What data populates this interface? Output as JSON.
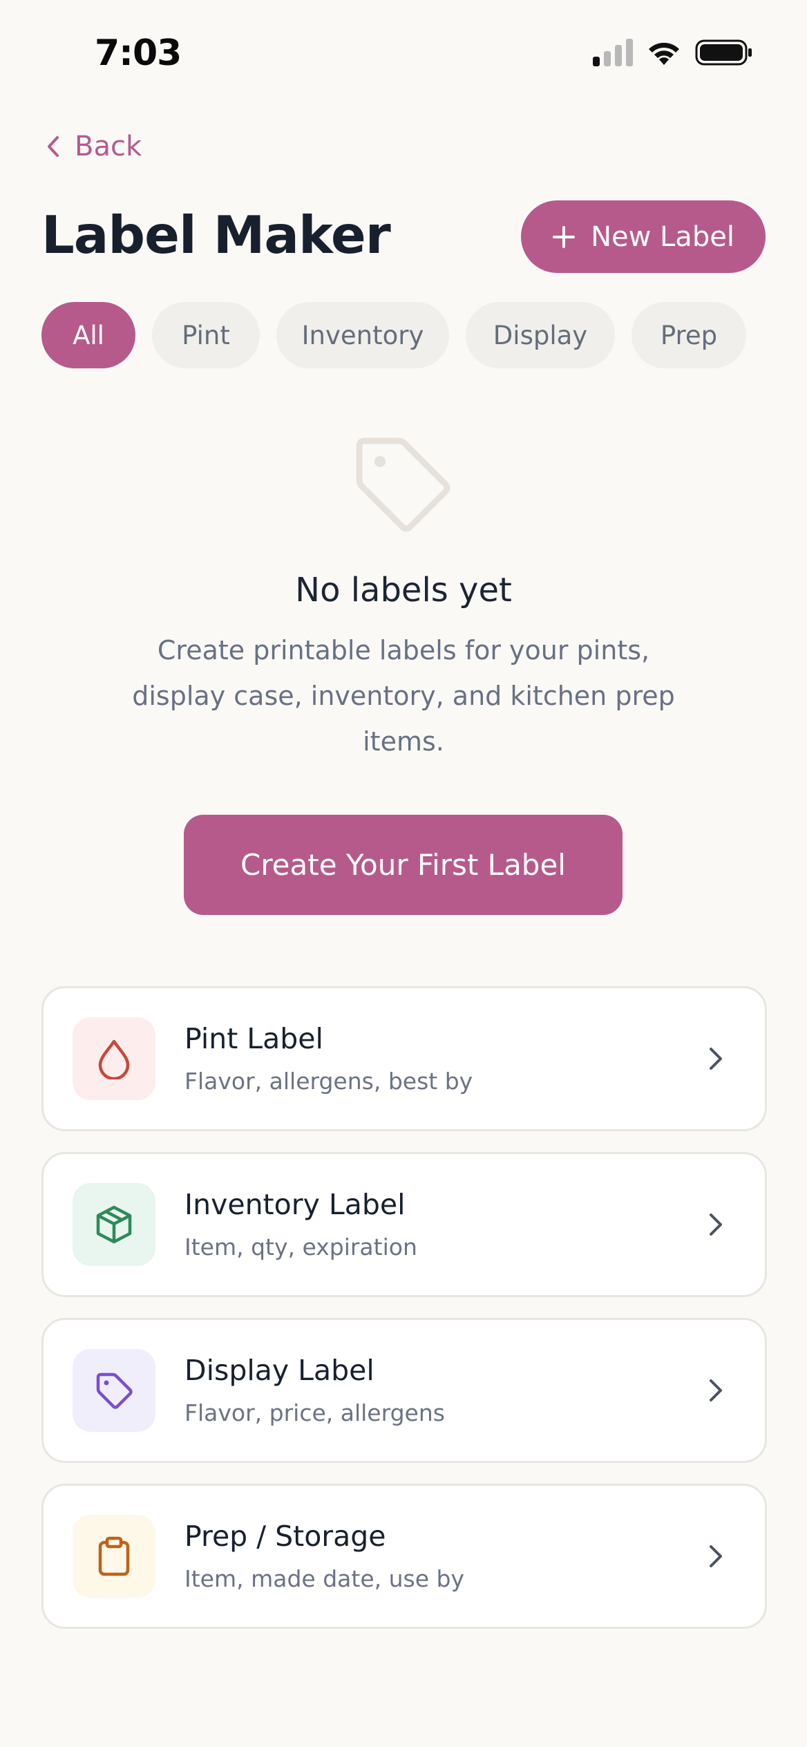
{
  "status_bar": {
    "time": "7:03"
  },
  "nav": {
    "back_label": "Back"
  },
  "header": {
    "title": "Label Maker",
    "new_button_label": "New Label"
  },
  "filters": [
    {
      "label": "All",
      "active": true
    },
    {
      "label": "Pint",
      "active": false
    },
    {
      "label": "Inventory",
      "active": false
    },
    {
      "label": "Display",
      "active": false
    },
    {
      "label": "Prep",
      "active": false
    }
  ],
  "empty_state": {
    "icon": "tag-icon",
    "title": "No labels yet",
    "description": "Create printable labels for your pints, display case, inventory, and kitchen prep items.",
    "cta_label": "Create Your First Label"
  },
  "templates": [
    {
      "icon": "droplet-icon",
      "title": "Pint Label",
      "subtitle": "Flavor, allergens, best by",
      "icon_bg": "#fdeeed",
      "icon_color": "#c8473c"
    },
    {
      "icon": "box-icon",
      "title": "Inventory Label",
      "subtitle": "Item, qty, expiration",
      "icon_bg": "#e9f5ef",
      "icon_color": "#2f8a5a"
    },
    {
      "icon": "tag-icon",
      "title": "Display Label",
      "subtitle": "Flavor, price, allergens",
      "icon_bg": "#f1eefc",
      "icon_color": "#7a4fd0"
    },
    {
      "icon": "clipboard-icon",
      "title": "Prep / Storage",
      "subtitle": "Item, made date, use by",
      "icon_bg": "#fdf8e8",
      "icon_color": "#c0611a"
    }
  ],
  "colors": {
    "accent": "#b65a8b",
    "background": "#faf9f6"
  }
}
